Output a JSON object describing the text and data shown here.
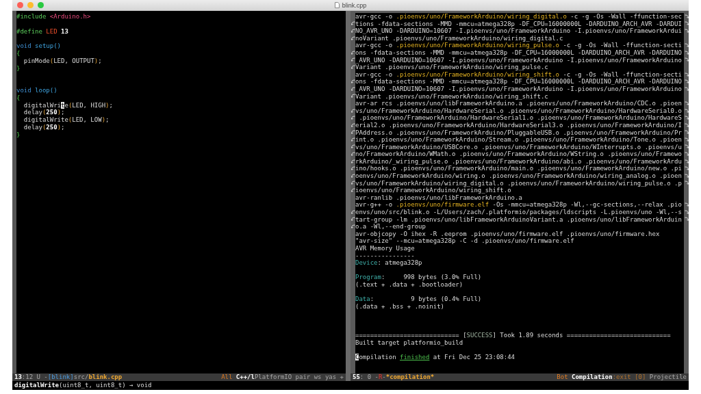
{
  "window": {
    "title": "blink.cpp"
  },
  "editor": {
    "lines": [
      {
        "kind": "text",
        "segments": [
          {
            "text": "#include",
            "kind": "pre"
          },
          {
            "text": " <Arduino.h>",
            "kind": "str"
          }
        ]
      },
      {
        "kind": "blank"
      },
      {
        "kind": "text",
        "segments": [
          {
            "text": "#define",
            "kind": "pre"
          },
          {
            "text": " LED",
            "kind": "const"
          },
          {
            "text": " 13",
            "kind": "num"
          }
        ]
      },
      {
        "kind": "blank"
      },
      {
        "kind": "text",
        "segments": [
          {
            "text": "void",
            "kind": "type"
          },
          {
            "text": " setup()",
            "kind": "fn"
          }
        ]
      },
      {
        "kind": "text",
        "segments": [
          {
            "text": "{",
            "kind": "brace"
          }
        ]
      },
      {
        "kind": "text",
        "segments": [
          {
            "text": "  pinMode",
            "kind": "plain"
          },
          {
            "text": "(",
            "kind": "paren"
          },
          {
            "text": "LED, OUTPUT",
            "kind": "plain"
          },
          {
            "text": ")",
            "kind": "paren"
          },
          {
            "text": ";",
            "kind": "plain"
          }
        ]
      },
      {
        "kind": "text",
        "segments": [
          {
            "text": "}",
            "kind": "brace"
          }
        ]
      },
      {
        "kind": "blank"
      },
      {
        "kind": "blank"
      },
      {
        "kind": "text",
        "segments": [
          {
            "text": "void",
            "kind": "type"
          },
          {
            "text": " loop()",
            "kind": "fn"
          }
        ]
      },
      {
        "kind": "text",
        "segments": [
          {
            "text": "{",
            "kind": "brace"
          }
        ]
      },
      {
        "kind": "text",
        "segments": [
          {
            "text": "  digitalWri",
            "kind": "plain"
          },
          {
            "text": "t",
            "kind": "cursor"
          },
          {
            "text": "e",
            "kind": "plain"
          },
          {
            "text": "(",
            "kind": "paren"
          },
          {
            "text": "LED, HIGH",
            "kind": "plain"
          },
          {
            "text": ")",
            "kind": "paren"
          },
          {
            "text": ";",
            "kind": "plain"
          }
        ]
      },
      {
        "kind": "text",
        "segments": [
          {
            "text": "  delay",
            "kind": "plain"
          },
          {
            "text": "(",
            "kind": "paren"
          },
          {
            "text": "250",
            "kind": "num"
          },
          {
            "text": ")",
            "kind": "paren"
          },
          {
            "text": ";",
            "kind": "plain"
          }
        ]
      },
      {
        "kind": "text",
        "segments": [
          {
            "text": "  digitalWrite",
            "kind": "plain"
          },
          {
            "text": "(",
            "kind": "paren"
          },
          {
            "text": "LED, LOW",
            "kind": "plain"
          },
          {
            "text": ")",
            "kind": "paren"
          },
          {
            "text": ";",
            "kind": "plain"
          }
        ]
      },
      {
        "kind": "text",
        "segments": [
          {
            "text": "  delay",
            "kind": "plain"
          },
          {
            "text": "(",
            "kind": "paren"
          },
          {
            "text": "250",
            "kind": "num"
          },
          {
            "text": ")",
            "kind": "paren"
          },
          {
            "text": ";",
            "kind": "plain"
          }
        ]
      },
      {
        "kind": "text",
        "segments": [
          {
            "text": "}",
            "kind": "brace"
          }
        ]
      }
    ],
    "mode_line": {
      "left": [
        {
          "text": "13",
          "kind": "bold"
        },
        {
          "text": ":12 U -",
          "kind": "dim"
        },
        {
          "text": "[blink]",
          "kind": "project"
        },
        {
          "text": "src/",
          "kind": "dim"
        },
        {
          "text": "blink.cpp",
          "kind": "file"
        }
      ],
      "right": [
        {
          "text": "All ",
          "kind": "warn"
        },
        {
          "text": "C++/l",
          "kind": "bold"
        },
        {
          "text": "PlatformIO pair ws yas +",
          "kind": "dim"
        }
      ]
    }
  },
  "compilation": {
    "lines": [
      {
        "kind": "text",
        "wraps": false,
        "continues": true,
        "segments": [
          {
            "text": "avr-gcc -o ",
            "kind": "plain"
          },
          {
            "text": ".pioenvs/uno/FrameworkArduino/wiring_digital.o",
            "kind": "path"
          },
          {
            "text": " -c -g -Os -Wall -ffunction-sec",
            "kind": "plain"
          }
        ]
      },
      {
        "kind": "text",
        "wraps": true,
        "continues": true,
        "segments": [
          {
            "text": "tions -fdata-sections -MMD -mmcu=atmega328p -DF_CPU=16000000L -DARDUINO_ARCH_AVR -DARDUI",
            "kind": "plain"
          }
        ]
      },
      {
        "kind": "text",
        "wraps": true,
        "continues": true,
        "segments": [
          {
            "text": "NO_AVR_UNO -DARDUINO=10607 -I.pioenvs/uno/FrameworkArduino -I.pioenvs/uno/FrameworkArdui",
            "kind": "plain"
          }
        ]
      },
      {
        "kind": "text",
        "wraps": true,
        "continues": false,
        "segments": [
          {
            "text": "noVariant .pioenvs/uno/FrameworkArduino/wiring_digital.c",
            "kind": "plain"
          }
        ]
      },
      {
        "kind": "text",
        "wraps": false,
        "continues": true,
        "segments": [
          {
            "text": "avr-gcc -o ",
            "kind": "plain"
          },
          {
            "text": ".pioenvs/uno/FrameworkArduino/wiring_pulse.o",
            "kind": "path"
          },
          {
            "text": " -c -g -Os -Wall -ffunction-secti",
            "kind": "plain"
          }
        ]
      },
      {
        "kind": "text",
        "wraps": true,
        "continues": true,
        "segments": [
          {
            "text": "ons -fdata-sections -MMD -mmcu=atmega328p -DF_CPU=16000000L -DARDUINO_ARCH_AVR -DARDUINO",
            "kind": "plain"
          }
        ]
      },
      {
        "kind": "text",
        "wraps": true,
        "continues": true,
        "segments": [
          {
            "text": "_AVR_UNO -DARDUINO=10607 -I.pioenvs/uno/FrameworkArduino -I.pioenvs/uno/FrameworkArduino",
            "kind": "plain"
          }
        ]
      },
      {
        "kind": "text",
        "wraps": true,
        "continues": false,
        "segments": [
          {
            "text": "Variant .pioenvs/uno/FrameworkArduino/wiring_pulse.c",
            "kind": "plain"
          }
        ]
      },
      {
        "kind": "text",
        "wraps": false,
        "continues": true,
        "segments": [
          {
            "text": "avr-gcc -o ",
            "kind": "plain"
          },
          {
            "text": ".pioenvs/uno/FrameworkArduino/wiring_shift.o",
            "kind": "path"
          },
          {
            "text": " -c -g -Os -Wall -ffunction-secti",
            "kind": "plain"
          }
        ]
      },
      {
        "kind": "text",
        "wraps": true,
        "continues": true,
        "segments": [
          {
            "text": "ons -fdata-sections -MMD -mmcu=atmega328p -DF_CPU=16000000L -DARDUINO_ARCH_AVR -DARDUINO",
            "kind": "plain"
          }
        ]
      },
      {
        "kind": "text",
        "wraps": true,
        "continues": true,
        "segments": [
          {
            "text": "_AVR_UNO -DARDUINO=10607 -I.pioenvs/uno/FrameworkArduino -I.pioenvs/uno/FrameworkArduino",
            "kind": "plain"
          }
        ]
      },
      {
        "kind": "text",
        "wraps": true,
        "continues": false,
        "segments": [
          {
            "text": "Variant .pioenvs/uno/FrameworkArduino/wiring_shift.c",
            "kind": "plain"
          }
        ]
      },
      {
        "kind": "text",
        "wraps": false,
        "continues": true,
        "segments": [
          {
            "text": "avr-ar rcs .pioenvs/uno/libFrameworkArduino.a .pioenvs/uno/FrameworkArduino/CDC.o .pioen",
            "kind": "plain"
          }
        ]
      },
      {
        "kind": "text",
        "wraps": true,
        "continues": true,
        "segments": [
          {
            "text": "vs/uno/FrameworkArduino/HardwareSerial.o .pioenvs/uno/FrameworkArduino/HardwareSerial0.o",
            "kind": "plain"
          }
        ]
      },
      {
        "kind": "text",
        "wraps": true,
        "continues": true,
        "segments": [
          {
            "text": " .pioenvs/uno/FrameworkArduino/HardwareSerial1.o .pioenvs/uno/FrameworkArduino/HardwareS",
            "kind": "plain"
          }
        ]
      },
      {
        "kind": "text",
        "wraps": true,
        "continues": true,
        "segments": [
          {
            "text": "erial2.o .pioenvs/uno/FrameworkArduino/HardwareSerial3.o .pioenvs/uno/FrameworkArduino/I",
            "kind": "plain"
          }
        ]
      },
      {
        "kind": "text",
        "wraps": true,
        "continues": true,
        "segments": [
          {
            "text": "PAddress.o .pioenvs/uno/FrameworkArduino/PluggableUSB.o .pioenvs/uno/FrameworkArduino/Pr",
            "kind": "plain"
          }
        ]
      },
      {
        "kind": "text",
        "wraps": true,
        "continues": true,
        "segments": [
          {
            "text": "int.o .pioenvs/uno/FrameworkArduino/Stream.o .pioenvs/uno/FrameworkArduino/Tone.o .pioen",
            "kind": "plain"
          }
        ]
      },
      {
        "kind": "text",
        "wraps": true,
        "continues": true,
        "segments": [
          {
            "text": "vs/uno/FrameworkArduino/USBCore.o .pioenvs/uno/FrameworkArduino/WInterrupts.o .pioenvs/u",
            "kind": "plain"
          }
        ]
      },
      {
        "kind": "text",
        "wraps": true,
        "continues": true,
        "segments": [
          {
            "text": "no/FrameworkArduino/WMath.o .pioenvs/uno/FrameworkArduino/WString.o .pioenvs/uno/Framewo",
            "kind": "plain"
          }
        ]
      },
      {
        "kind": "text",
        "wraps": true,
        "continues": true,
        "segments": [
          {
            "text": "rkArduino/_wiring_pulse.o .pioenvs/uno/FrameworkArduino/abi.o .pioenvs/uno/FrameworkArdu",
            "kind": "plain"
          }
        ]
      },
      {
        "kind": "text",
        "wraps": true,
        "continues": true,
        "segments": [
          {
            "text": "ino/hooks.o .pioenvs/uno/FrameworkArduino/main.o .pioenvs/uno/FrameworkArduino/new.o .pi",
            "kind": "plain"
          }
        ]
      },
      {
        "kind": "text",
        "wraps": true,
        "continues": true,
        "segments": [
          {
            "text": "oenvs/uno/FrameworkArduino/wiring.o .pioenvs/uno/FrameworkArduino/wiring_analog.o .pioen",
            "kind": "plain"
          }
        ]
      },
      {
        "kind": "text",
        "wraps": true,
        "continues": true,
        "segments": [
          {
            "text": "vs/uno/FrameworkArduino/wiring_digital.o .pioenvs/uno/FrameworkArduino/wiring_pulse.o .p",
            "kind": "plain"
          }
        ]
      },
      {
        "kind": "text",
        "wraps": true,
        "continues": false,
        "segments": [
          {
            "text": "ioenvs/uno/FrameworkArduino/wiring_shift.o",
            "kind": "plain"
          }
        ]
      },
      {
        "kind": "text",
        "wraps": false,
        "continues": false,
        "segments": [
          {
            "text": "avr-ranlib .pioenvs/uno/libFrameworkArduino.a",
            "kind": "plain"
          }
        ]
      },
      {
        "kind": "text",
        "wraps": false,
        "continues": true,
        "segments": [
          {
            "text": "avr-g++ -o ",
            "kind": "plain"
          },
          {
            "text": ".pioenvs/uno/firmware.elf",
            "kind": "path"
          },
          {
            "text": " -Os -mmcu=atmega328p -Wl,--gc-sections,--relax .pio",
            "kind": "plain"
          }
        ]
      },
      {
        "kind": "text",
        "wraps": true,
        "continues": true,
        "segments": [
          {
            "text": "envs/uno/src/blink.o -L/Users/zach/.platformio/packages/ldscripts -L.pioenvs/uno -Wl,--s",
            "kind": "plain"
          }
        ]
      },
      {
        "kind": "text",
        "wraps": true,
        "continues": true,
        "segments": [
          {
            "text": "tart-group -lm .pioenvs/uno/libFrameworkArduinoVariant.a .pioenvs/uno/libFrameworkArduin",
            "kind": "plain"
          }
        ]
      },
      {
        "kind": "text",
        "wraps": true,
        "continues": false,
        "segments": [
          {
            "text": "o.a -Wl,--end-group",
            "kind": "plain"
          }
        ]
      },
      {
        "kind": "text",
        "wraps": false,
        "continues": false,
        "segments": [
          {
            "text": "avr-objcopy -O ihex -R .eeprom .pioenvs/uno/firmware.elf .pioenvs/uno/firmware.hex",
            "kind": "plain"
          }
        ]
      },
      {
        "kind": "text",
        "wraps": false,
        "continues": false,
        "segments": [
          {
            "text": "\"avr-size\" --mcu=atmega328p -C -d .pioenvs/uno/firmware.elf",
            "kind": "plain"
          }
        ]
      },
      {
        "kind": "text",
        "wraps": false,
        "continues": false,
        "segments": [
          {
            "text": "AVR Memory Usage",
            "kind": "plain"
          }
        ]
      },
      {
        "kind": "text",
        "wraps": false,
        "continues": false,
        "segments": [
          {
            "text": "----------------",
            "kind": "plain"
          }
        ]
      },
      {
        "kind": "text",
        "wraps": false,
        "continues": false,
        "segments": [
          {
            "text": "Device",
            "kind": "label"
          },
          {
            "text": ": atmega328p",
            "kind": "plain"
          }
        ]
      },
      {
        "kind": "blank"
      },
      {
        "kind": "text",
        "wraps": false,
        "continues": false,
        "segments": [
          {
            "text": "Program",
            "kind": "label"
          },
          {
            "text": ":     998 bytes (3.0% Full)",
            "kind": "plain"
          }
        ]
      },
      {
        "kind": "text",
        "wraps": false,
        "continues": false,
        "segments": [
          {
            "text": "(.text + .data + .bootloader)",
            "kind": "plain"
          }
        ]
      },
      {
        "kind": "blank"
      },
      {
        "kind": "text",
        "wraps": false,
        "continues": false,
        "segments": [
          {
            "text": "Data",
            "kind": "label"
          },
          {
            "text": ":          9 bytes (0.4% Full)",
            "kind": "plain"
          }
        ]
      },
      {
        "kind": "text",
        "wraps": false,
        "continues": false,
        "segments": [
          {
            "text": "(.data + .bss + .noinit)",
            "kind": "plain"
          }
        ]
      },
      {
        "kind": "blank"
      },
      {
        "kind": "blank"
      },
      {
        "kind": "blank"
      },
      {
        "kind": "text",
        "wraps": false,
        "continues": false,
        "segments": [
          {
            "text": "============================ [",
            "kind": "plain"
          },
          {
            "text": "SUCCESS",
            "kind": "tag"
          },
          {
            "text": "] Took 1.89 seconds ============================",
            "kind": "plain"
          }
        ]
      },
      {
        "kind": "text",
        "wraps": false,
        "continues": false,
        "segments": [
          {
            "text": "Built target platformio_build",
            "kind": "plain"
          }
        ]
      },
      {
        "kind": "blank"
      },
      {
        "kind": "text",
        "wraps": false,
        "continues": false,
        "segments": [
          {
            "text": "C",
            "kind": "cursor"
          },
          {
            "text": "ompilation ",
            "kind": "plain"
          },
          {
            "text": "finished",
            "kind": "link"
          },
          {
            "text": " at Fri Dec 25 23:08:44",
            "kind": "plain"
          }
        ]
      }
    ],
    "mode_line": {
      "left": [
        {
          "text": "55",
          "kind": "bold"
        },
        {
          "text": ": 0 -",
          "kind": "dim"
        },
        {
          "text": "R",
          "kind": "error"
        },
        {
          "text": "-",
          "kind": "dim"
        },
        {
          "text": "*compilation*",
          "kind": "file"
        }
      ],
      "right": [
        {
          "text": "Bot ",
          "kind": "warn"
        },
        {
          "text": "Compilation",
          "kind": "bold"
        },
        {
          "text": ":exit [0] ",
          "kind": "warnDim"
        },
        {
          "text": "Projectile",
          "kind": "dim"
        }
      ]
    }
  },
  "echo_area": [
    {
      "text": "digitalWrite",
      "kind": "bold"
    },
    {
      "text": "(uint8_t, uint8_t) → void",
      "kind": "plain"
    }
  ]
}
